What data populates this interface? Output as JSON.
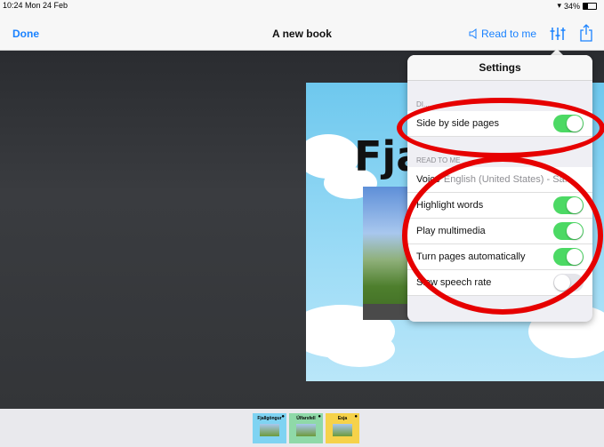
{
  "statusbar": {
    "time": "10:24  Mon 24 Feb",
    "battery": "34%"
  },
  "navbar": {
    "done": "Done",
    "title": "A new book",
    "read_to_me": "Read to me",
    "settings_icon": "sliders-icon",
    "share_icon": "share-icon"
  },
  "page": {
    "title": "Fja"
  },
  "settings": {
    "title": "Settings",
    "section1_header": "DI...",
    "side_by_side": {
      "label": "Side by side pages",
      "on": true
    },
    "section2_header": "READ TO ME",
    "voice": {
      "label": "Voice",
      "value": "English (United States) - Sa..."
    },
    "highlight": {
      "label": "Highlight words",
      "on": true
    },
    "multimedia": {
      "label": "Play multimedia",
      "on": true
    },
    "turn_pages": {
      "label": "Turn pages automatically",
      "on": true
    },
    "slow_rate": {
      "label": "Slow speech rate",
      "on": false
    }
  },
  "thumbnails": [
    {
      "label": "Fjallgöngur",
      "color": "#7fd3f2"
    },
    {
      "label": "Úlfarsfell",
      "color": "#8fd9a8"
    },
    {
      "label": "Esja",
      "color": "#f6d24a"
    }
  ],
  "colors": {
    "accent": "#1a82ff",
    "toggle_on": "#4cd964",
    "annotation": "#e60000"
  }
}
